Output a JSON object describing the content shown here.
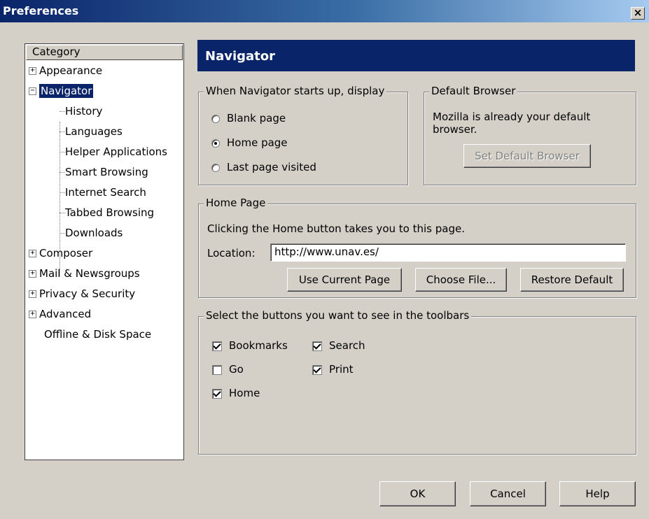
{
  "window": {
    "title": "Preferences",
    "close_glyph": "×"
  },
  "sidebar": {
    "header": "Category",
    "items": [
      {
        "label": "Appearance",
        "expander": "+"
      },
      {
        "label": "Navigator",
        "expander": "−"
      },
      {
        "label": "History"
      },
      {
        "label": "Languages"
      },
      {
        "label": "Helper Applications"
      },
      {
        "label": "Smart Browsing"
      },
      {
        "label": "Internet Search"
      },
      {
        "label": "Tabbed Browsing"
      },
      {
        "label": "Downloads"
      },
      {
        "label": "Composer",
        "expander": "+"
      },
      {
        "label": "Mail & Newsgroups",
        "expander": "+"
      },
      {
        "label": "Privacy & Security",
        "expander": "+"
      },
      {
        "label": "Advanced",
        "expander": "+"
      },
      {
        "label": "Offline & Disk Space"
      }
    ]
  },
  "panel": {
    "title": "Navigator",
    "startup": {
      "legend": "When Navigator starts up, display",
      "options": [
        "Blank page",
        "Home page",
        "Last page visited"
      ],
      "selected": "Home page"
    },
    "default_browser": {
      "legend": "Default Browser",
      "message": "Mozilla is already your default browser.",
      "button": "Set Default Browser"
    },
    "home_page": {
      "legend": "Home Page",
      "description": "Clicking the Home button takes you to this page.",
      "location_label": "Location:",
      "location_value": "http://www.unav.es/",
      "buttons": [
        "Use Current Page",
        "Choose File...",
        "Restore Default"
      ]
    },
    "toolbar": {
      "legend": "Select the buttons you want to see in the toolbars",
      "items": [
        {
          "label": "Bookmarks",
          "checked": true
        },
        {
          "label": "Search",
          "checked": true
        },
        {
          "label": "Go",
          "checked": false
        },
        {
          "label": "Print",
          "checked": true
        },
        {
          "label": "Home",
          "checked": true
        }
      ]
    }
  },
  "footer": {
    "ok": "OK",
    "cancel": "Cancel",
    "help": "Help"
  },
  "colors": {
    "dialog_bg": "#d4d0c8",
    "header_bg": "#0a246a",
    "selection": "#0a246a"
  }
}
